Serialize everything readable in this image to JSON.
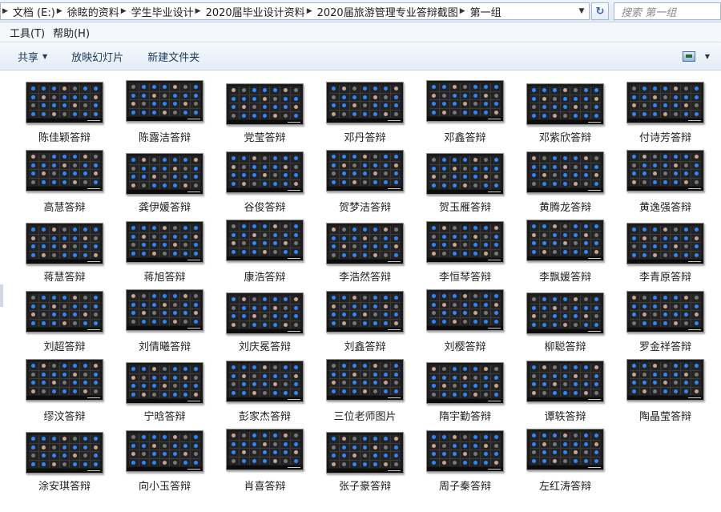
{
  "address_bar": {
    "crumbs": [
      "文档 (E:)",
      "徐眩的资料",
      "学生毕业设计",
      "2020届毕业设计资料",
      "2020届旅游管理专业答辩截图",
      "第一组"
    ],
    "search_placeholder": "搜索 第一组"
  },
  "menu": {
    "items": [
      "工具(T)",
      "帮助(H)"
    ]
  },
  "toolbar": {
    "share_label": "共享",
    "slideshow_label": "放映幻灯片",
    "new_folder_label": "新建文件夹"
  },
  "files": [
    "陈佳颖答辩",
    "陈露洁答辩",
    "党莹答辩",
    "邓丹答辩",
    "邓鑫答辩",
    "邓紫欣答辩",
    "付诗芳答辩",
    "高慧答辩",
    "龚伊媛答辩",
    "谷俊答辩",
    "贺梦洁答辩",
    "贺玉雁答辩",
    "黄腾龙答辩",
    "黄逸强答辩",
    "蒋慧答辩",
    "蒋旭答辩",
    "康浩答辩",
    "李浩然答辩",
    "李恒琴答辩",
    "李飘媛答辩",
    "李青原答辩",
    "刘超答辩",
    "刘倩曦答辩",
    "刘庆冕答辩",
    "刘鑫答辩",
    "刘樱答辩",
    "柳聪答辩",
    "罗金祥答辩",
    "缪汶答辩",
    "宁晗答辩",
    "彭家杰答辩",
    "三位老师图片",
    "隋宇勤答辩",
    "谭轶答辩",
    "陶晶莹答辩",
    "涂安琪答辩",
    "向小玉答辩",
    "肖喜答辩",
    "张子豪答辩",
    "周子秦答辩",
    "左红涛答辩"
  ]
}
